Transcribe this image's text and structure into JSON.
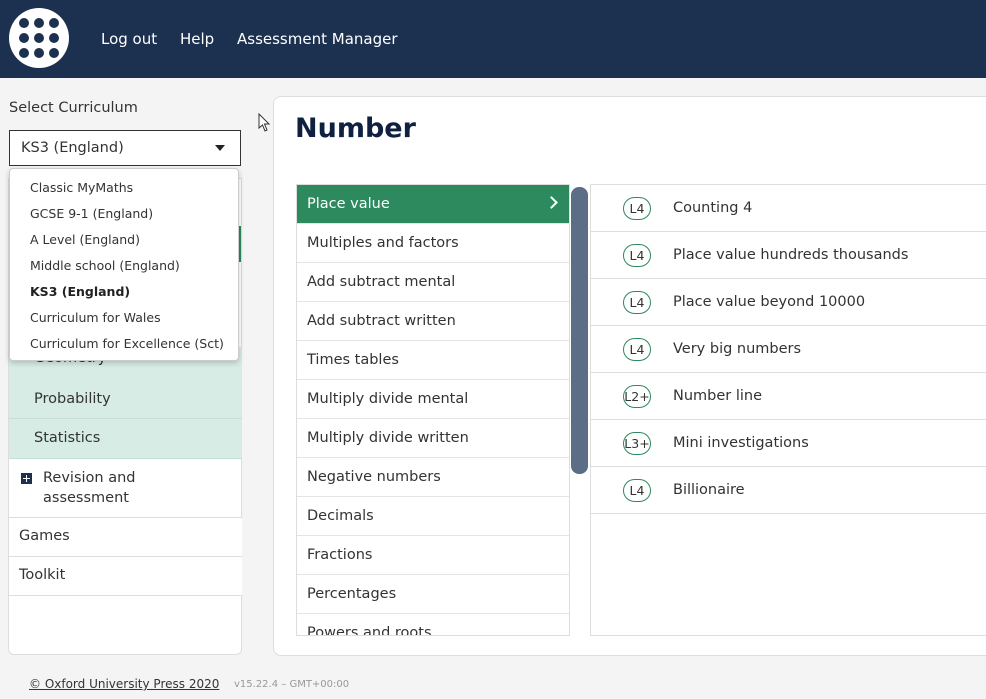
{
  "header": {
    "nav": [
      "Log out",
      "Help",
      "Assessment Manager"
    ],
    "logo_icon": "grid-dots-logo"
  },
  "curriculum": {
    "label": "Select Curriculum",
    "selected": "KS3 (England)",
    "options": [
      "Classic MyMaths",
      "GCSE 9-1 (England)",
      "A Level (England)",
      "Middle school (England)",
      "KS3 (England)",
      "Curriculum for Wales",
      "Curriculum for Excellence (Sct)"
    ]
  },
  "sidebar": {
    "sub_items": [
      "Geometry",
      "Probability",
      "Statistics"
    ],
    "main_items": [
      "Revision and assessment",
      "Games",
      "Toolkit"
    ]
  },
  "main": {
    "title": "Number",
    "topics": [
      "Place value",
      "Multiples and factors",
      "Add subtract mental",
      "Add subtract written",
      "Times tables",
      "Multiply divide mental",
      "Multiply divide written",
      "Negative numbers",
      "Decimals",
      "Fractions",
      "Percentages",
      "Powers and roots"
    ],
    "lessons": [
      {
        "level": "L4",
        "name": "Counting 4"
      },
      {
        "level": "L4",
        "name": "Place value hundreds thousands"
      },
      {
        "level": "L4",
        "name": "Place value beyond 10000"
      },
      {
        "level": "L4",
        "name": "Very big numbers"
      },
      {
        "level": "L2+",
        "name": "Number line"
      },
      {
        "level": "L3+",
        "name": "Mini investigations"
      },
      {
        "level": "L4",
        "name": "Billionaire"
      }
    ]
  },
  "footer": {
    "copyright": "© Oxford University Press 2020",
    "version": "v15.22.4 – GMT+00:00"
  },
  "colors": {
    "header": "#1c3050",
    "accent_green": "#2d8a5e",
    "sub_item_bg": "#d6ece4",
    "scroll_thumb": "#5b6e85"
  }
}
